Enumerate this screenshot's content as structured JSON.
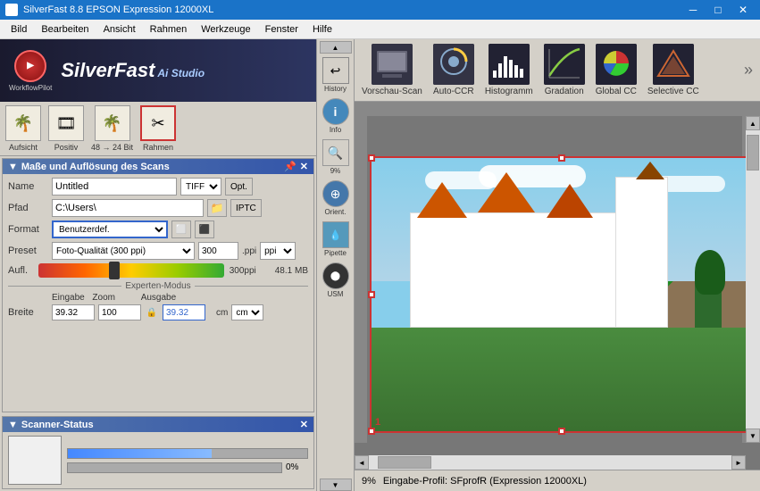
{
  "titlebar": {
    "title": "SilverFast 8.8 EPSON Expression 12000XL",
    "minimize": "─",
    "maximize": "□",
    "close": "✕"
  },
  "menubar": {
    "items": [
      "Bild",
      "Bearbeiten",
      "Ansicht",
      "Rahmen",
      "Werkzeuge",
      "Fenster",
      "Hilfe"
    ]
  },
  "logo": {
    "workflow_pilot_label": "WorkflowPilot",
    "sf_brand": "SilverFast",
    "sf_sub": "Ai Studio"
  },
  "toolbar_icons": [
    {
      "label": "Aufsicht",
      "icon": "🌴"
    },
    {
      "label": "Positiv",
      "icon": "🎞"
    },
    {
      "label": "48 → 24 Bit",
      "icon": "🌴"
    },
    {
      "label": "Rahmen",
      "icon": "✂"
    }
  ],
  "scan_panel": {
    "title": "Maße und Auflösung des Scans",
    "name_label": "Name",
    "name_value": "Untitled",
    "name_format": "TIFF",
    "name_opt_btn": "Opt.",
    "path_label": "Pfad",
    "path_value": "C:\\Users\\",
    "path_iptc_btn": "IPTC",
    "format_label": "Format",
    "format_value": "Benutzerdef.",
    "preset_label": "Preset",
    "preset_value": "Foto-Qualität (300 ppi)",
    "preset_ppi_value": "300",
    "preset_ppi_unit": ".ppi",
    "aufl_label": "Aufl.",
    "aufl_value": "300ppi",
    "aufl_size": "48.1 MB",
    "expert_mode_label": "Experten-Modus",
    "eingabe_label": "Eingabe",
    "zoom_label": "Zoom",
    "ausgabe_label": "Ausgabe",
    "breite_label": "Breite",
    "breite_eingabe": "39.32",
    "breite_zoom": "100",
    "breite_ausgabe": "39.32",
    "unit": "cm"
  },
  "scanner_panel": {
    "title": "Scanner-Status",
    "progress1": "0%"
  },
  "sidebar_tools": [
    {
      "label": "History",
      "icon": "↩"
    },
    {
      "label": "Info",
      "icon": "ℹ"
    },
    {
      "label": "9%",
      "icon": "🔍"
    },
    {
      "label": "Orient.",
      "icon": "⊕"
    },
    {
      "label": "Pipette",
      "icon": "💉"
    },
    {
      "label": "USM",
      "icon": "⬤"
    }
  ],
  "top_toolbar": {
    "items": [
      {
        "label": "Vorschau-Scan"
      },
      {
        "label": "Auto-CCR"
      },
      {
        "label": "Histogramm"
      },
      {
        "label": "Gradation"
      },
      {
        "label": "Global CC"
      },
      {
        "label": "Selective CC"
      }
    ]
  },
  "status_bar": {
    "zoom": "9%",
    "profile": "Eingabe-Profil: SFprofR (Expression 12000XL)"
  }
}
